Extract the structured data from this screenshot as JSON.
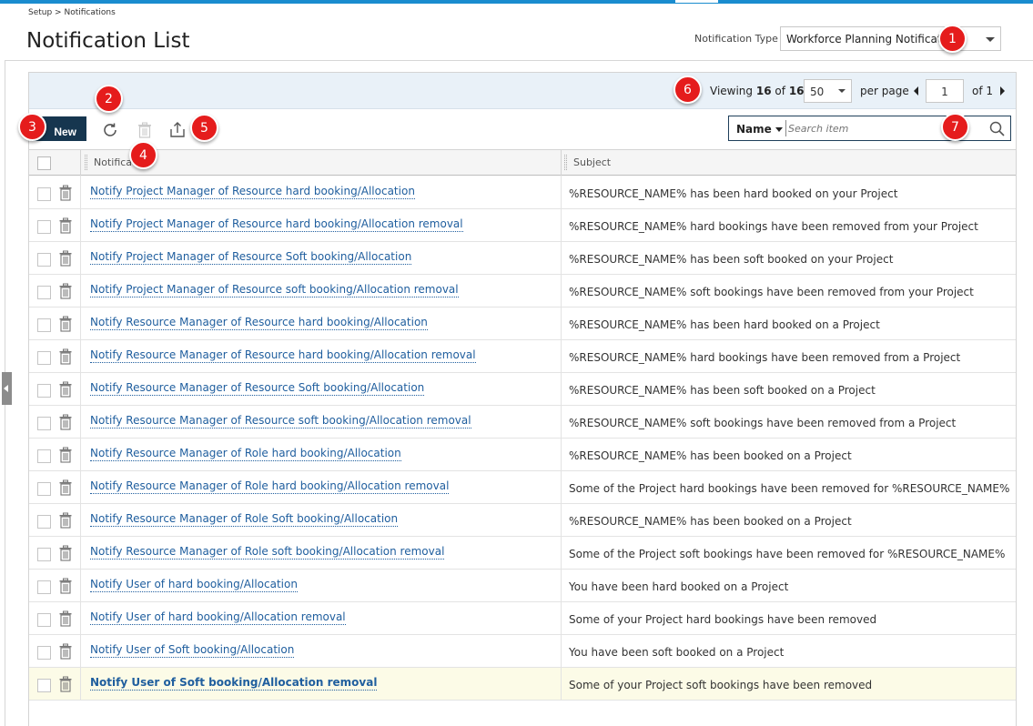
{
  "breadcrumb": "Setup > Notifications",
  "page_title": "Notification List",
  "notification_type": {
    "label": "Notification Type",
    "value": "Workforce Planning Notifications"
  },
  "pager": {
    "viewing_label": "Viewing",
    "viewing_count": "16",
    "of_label": "of",
    "total": "16",
    "per_page_value": "50",
    "per_page_label": "per page",
    "current_page": "1",
    "page_of": "of 1"
  },
  "toolbar": {
    "new_label": "New"
  },
  "search": {
    "field": "Name",
    "placeholder": "Search item"
  },
  "columns": {
    "name": "Notifica",
    "subject": "Subject"
  },
  "annotations": [
    "1",
    "2",
    "3",
    "4",
    "5",
    "6",
    "7"
  ],
  "rows": [
    {
      "name": "Notify Project Manager of Resource hard booking/Allocation",
      "subject": "%RESOURCE_NAME% has been hard booked on your Project"
    },
    {
      "name": "Notify Project Manager of Resource hard booking/Allocation removal",
      "subject": "%RESOURCE_NAME% hard bookings have been removed from your Project"
    },
    {
      "name": "Notify Project Manager of Resource Soft booking/Allocation",
      "subject": "%RESOURCE_NAME% has been soft booked on your Project"
    },
    {
      "name": "Notify Project Manager of Resource soft booking/Allocation removal",
      "subject": "%RESOURCE_NAME% soft bookings have been removed from your Project"
    },
    {
      "name": "Notify Resource Manager of Resource hard booking/Allocation",
      "subject": "%RESOURCE_NAME% has been hard booked on a Project"
    },
    {
      "name": "Notify Resource Manager of Resource hard booking/Allocation removal",
      "subject": "%RESOURCE_NAME% hard bookings have been removed from a Project"
    },
    {
      "name": "Notify Resource Manager of Resource Soft booking/Allocation",
      "subject": "%RESOURCE_NAME% has been soft booked on a Project"
    },
    {
      "name": "Notify Resource Manager of Resource soft booking/Allocation removal",
      "subject": "%RESOURCE_NAME% soft bookings have been removed from a Project"
    },
    {
      "name": "Notify Resource Manager of Role hard booking/Allocation",
      "subject": "%RESOURCE_NAME% has been booked on a Project"
    },
    {
      "name": "Notify Resource Manager of Role hard booking/Allocation removal",
      "subject": "Some of the Project hard bookings have been removed for %RESOURCE_NAME%"
    },
    {
      "name": "Notify Resource Manager of Role Soft booking/Allocation",
      "subject": "%RESOURCE_NAME% has been booked on a Project"
    },
    {
      "name": "Notify Resource Manager of Role soft booking/Allocation removal",
      "subject": "Some of the Project soft bookings have been removed for %RESOURCE_NAME%"
    },
    {
      "name": "Notify User of hard booking/Allocation",
      "subject": "You have been hard booked on a Project"
    },
    {
      "name": "Notify User of hard booking/Allocation removal",
      "subject": "Some of your Project hard bookings have been removed"
    },
    {
      "name": "Notify User of Soft booking/Allocation",
      "subject": "You have been soft booked on a Project"
    },
    {
      "name": "Notify User of Soft booking/Allocation removal",
      "subject": "Some of your Project soft bookings have been removed"
    }
  ],
  "colors": {
    "accent_bar": "#1a8ccf",
    "new_button": "#16364f",
    "link": "#1f5e9e",
    "annotation": "#e51c1c",
    "pager_bg": "#e9f1f8",
    "highlight_row": "#fcfbe7"
  }
}
